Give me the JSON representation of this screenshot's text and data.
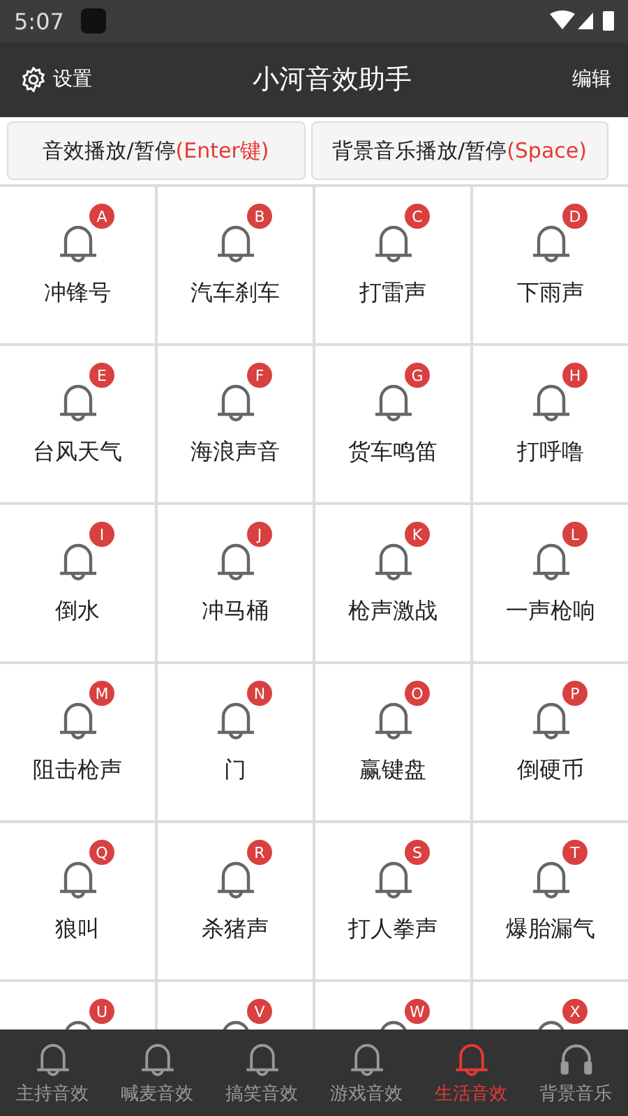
{
  "status_bar": {
    "time": "5:07"
  },
  "header": {
    "settings": "设置",
    "title": "小河音效助手",
    "edit": "编辑"
  },
  "play_buttons": [
    {
      "label": "音效播放/暂停",
      "key": "(Enter键)"
    },
    {
      "label": "背景音乐播放/暂停",
      "key": "(Space)"
    }
  ],
  "sounds": [
    {
      "badge": "A",
      "label": "冲锋号"
    },
    {
      "badge": "B",
      "label": "汽车刹车"
    },
    {
      "badge": "C",
      "label": "打雷声"
    },
    {
      "badge": "D",
      "label": "下雨声"
    },
    {
      "badge": "E",
      "label": "台风天气"
    },
    {
      "badge": "F",
      "label": "海浪声音"
    },
    {
      "badge": "G",
      "label": "货车鸣笛"
    },
    {
      "badge": "H",
      "label": "打呼噜"
    },
    {
      "badge": "I",
      "label": "倒水"
    },
    {
      "badge": "J",
      "label": "冲马桶"
    },
    {
      "badge": "K",
      "label": "枪声激战"
    },
    {
      "badge": "L",
      "label": "一声枪响"
    },
    {
      "badge": "M",
      "label": "阻击枪声"
    },
    {
      "badge": "N",
      "label": "门"
    },
    {
      "badge": "O",
      "label": "赢键盘"
    },
    {
      "badge": "P",
      "label": "倒硬币"
    },
    {
      "badge": "Q",
      "label": "狼叫"
    },
    {
      "badge": "R",
      "label": "杀猪声"
    },
    {
      "badge": "S",
      "label": "打人拳声"
    },
    {
      "badge": "T",
      "label": "爆胎漏气"
    },
    {
      "badge": "U"
    },
    {
      "badge": "V"
    },
    {
      "badge": "W"
    },
    {
      "badge": "X"
    }
  ],
  "bottom_nav": [
    {
      "label": "主持音效",
      "kind": "bell",
      "selected": false
    },
    {
      "label": "喊麦音效",
      "kind": "bell",
      "selected": false
    },
    {
      "label": "搞笑音效",
      "kind": "bell",
      "selected": false
    },
    {
      "label": "游戏音效",
      "kind": "bell",
      "selected": false
    },
    {
      "label": "生活音效",
      "kind": "bell",
      "selected": true
    },
    {
      "label": "背景音乐",
      "kind": "headphones",
      "selected": false
    }
  ]
}
